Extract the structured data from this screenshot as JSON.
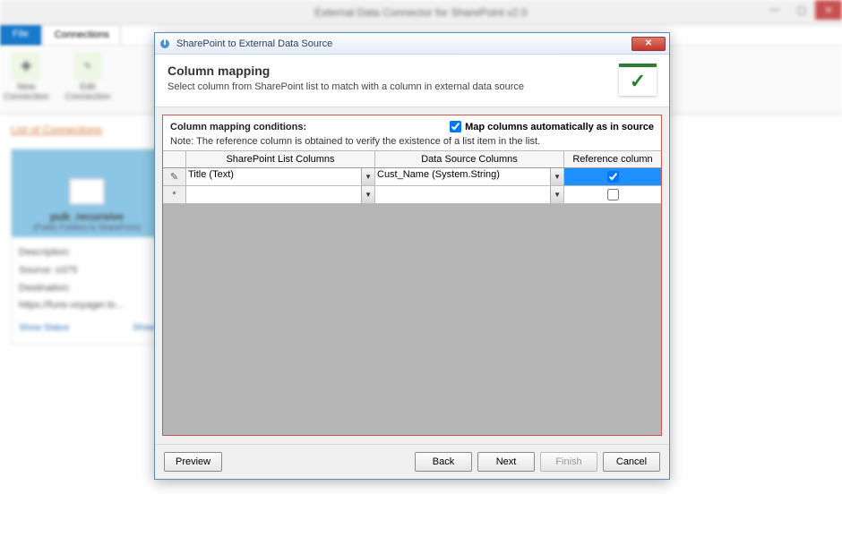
{
  "bg": {
    "title": "External Data Connector for SharePoint v2.0",
    "filetab": "File",
    "tab_connections": "Connections",
    "tool_new": "New\nConnection",
    "tool_edit": "Edit\nConnection",
    "list_heading": "List of Connections",
    "card_name": "pub_recursive",
    "card_sub": "(Public Folders to SharePoint)",
    "desc_label": "Description:",
    "source_label": "Source: o375",
    "dest_label": "Destination: https://funo.voyager.lo...",
    "link_showstatus": "Show Status",
    "link_show": "Show"
  },
  "modal": {
    "title": "SharePoint to External Data Source",
    "heading": "Column mapping",
    "sub": "Select column from SharePoint list to match with a column in external data source",
    "cond_label": "Column mapping conditions:",
    "auto_label": "Map columns automatically as in source",
    "auto_checked": true,
    "note": "Note: The reference column is obtained to verify the existence of a list item in the list.",
    "col_sp": "SharePoint List Columns",
    "col_ds": "Data Source Columns",
    "col_ref": "Reference column",
    "row1_sp": "Title (Text)",
    "row1_ds": "Cust_Name (System.String)",
    "row1_ref": true,
    "row2_ref": false,
    "btn_preview": "Preview",
    "btn_back": "Back",
    "btn_next": "Next",
    "btn_finish": "Finish",
    "btn_cancel": "Cancel"
  }
}
